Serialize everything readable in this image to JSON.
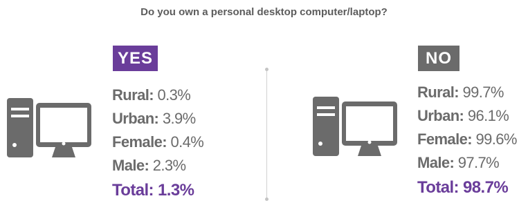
{
  "question": "Do you own a personal desktop computer/laptop?",
  "colors": {
    "accent_purple": "#6a3d9a",
    "gray": "#6b6b6b",
    "divider": "#d2d2d2"
  },
  "icons": {
    "computer": "desktop-computer-icon"
  },
  "chart_data": {
    "type": "table",
    "title": "Do you own a personal desktop computer/laptop?",
    "groups": [
      {
        "badge": "YES",
        "rows": [
          {
            "label": "Rural:",
            "value": "0.3%",
            "number": 0.3
          },
          {
            "label": "Urban:",
            "value": "3.9%",
            "number": 3.9
          },
          {
            "label": "Female:",
            "value": "0.4%",
            "number": 0.4
          },
          {
            "label": "Male:",
            "value": "2.3%",
            "number": 2.3
          }
        ],
        "total": {
          "label": "Total:",
          "value": "1.3%",
          "number": 1.3
        }
      },
      {
        "badge": "NO",
        "rows": [
          {
            "label": "Rural:",
            "value": "99.7%",
            "number": 99.7
          },
          {
            "label": "Urban:",
            "value": "96.1%",
            "number": 96.1
          },
          {
            "label": "Female:",
            "value": "99.6%",
            "number": 99.6
          },
          {
            "label": "Male:",
            "value": "97.7%",
            "number": 97.7
          }
        ],
        "total": {
          "label": "Total:",
          "value": "98.7%",
          "number": 98.7
        }
      }
    ]
  }
}
